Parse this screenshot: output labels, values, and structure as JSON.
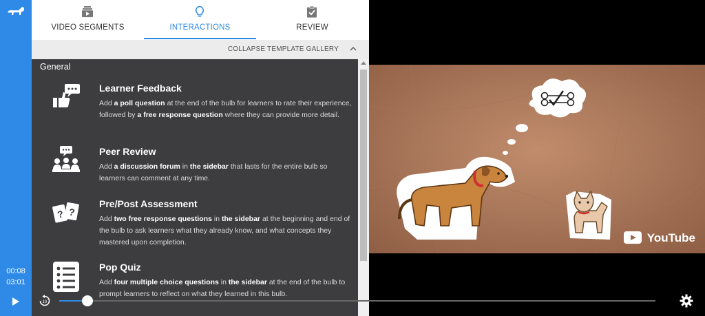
{
  "player": {
    "elapsed": "00:08",
    "duration": "03:01",
    "progress_fraction": 0.047
  },
  "tabs": [
    {
      "label": "VIDEO SEGMENTS",
      "icon": "video-segments-icon",
      "active": false
    },
    {
      "label": "INTERACTIONS",
      "icon": "lightbulb-icon",
      "active": true
    },
    {
      "label": "REVIEW",
      "icon": "clipboard-check-icon",
      "active": false
    }
  ],
  "gallery": {
    "collapse_label": "COLLAPSE TEMPLATE GALLERY",
    "section_title": "General",
    "items": [
      {
        "title": "Learner Feedback",
        "icon": "thumbs-up-speech-icon",
        "desc_parts": [
          "Add ",
          "a poll question",
          " at the end of the bulb for learners to rate their experience, followed by ",
          "a free response question",
          " where they can provide more detail."
        ]
      },
      {
        "title": "Peer Review",
        "icon": "group-discussion-icon",
        "desc_parts": [
          "Add ",
          "a discussion forum",
          " in ",
          "the sidebar",
          " that lasts for the entire bulb so learners can comment at any time."
        ]
      },
      {
        "title": "Pre/Post Assessment",
        "icon": "question-cards-icon",
        "desc_parts": [
          "Add ",
          "two free response questions",
          " in ",
          "the sidebar",
          " at the beginning and end of the bulb to ask learners what they already know, and what concepts they mastered upon completion."
        ]
      },
      {
        "title": "Pop Quiz",
        "icon": "checklist-icon",
        "desc_parts": [
          "Add ",
          "four multiple choice questions",
          " in ",
          "the sidebar",
          " at the end of the bulb to prompt learners to reflect on what they learned in this bulb."
        ]
      }
    ]
  },
  "video": {
    "watermark": "YouTube"
  },
  "colors": {
    "accent": "#2e8ae6",
    "gallery_bg": "#3d3d40",
    "video_bg": "#b07a5c"
  }
}
